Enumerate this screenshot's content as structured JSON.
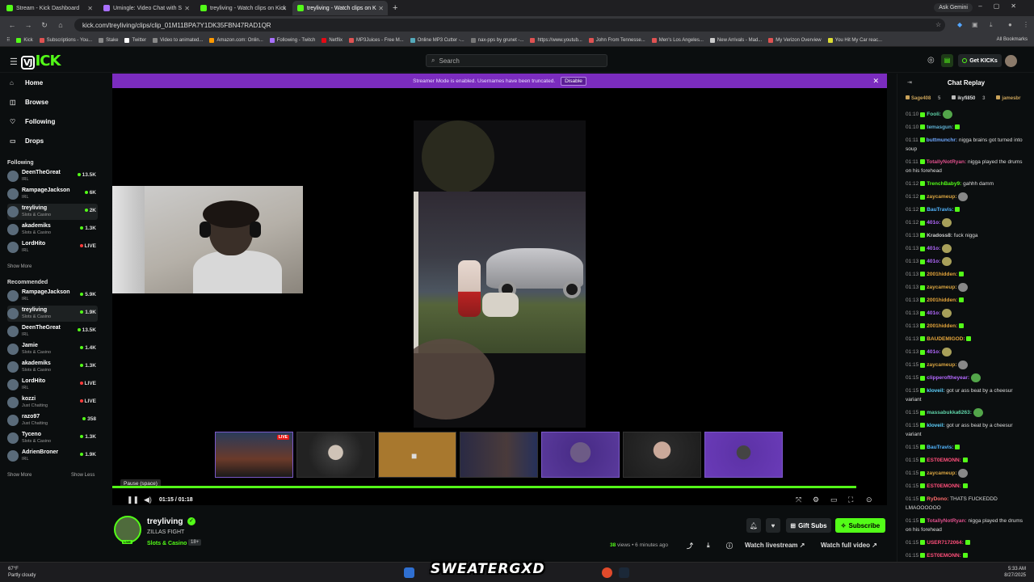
{
  "browser": {
    "tabs": [
      {
        "title": "Stream - Kick Dashboard",
        "active": false
      },
      {
        "title": "Umingle: Video Chat with S",
        "active": false
      },
      {
        "title": "treyliving - Watch clips on Kick",
        "active": false
      },
      {
        "title": "treyliving - Watch clips on K",
        "active": true
      }
    ],
    "ask_gemini": "Ask Gemini",
    "url": "kick.com/treyliving/clips/clip_01M11BPA7Y1DK35FBN47RAD1QR",
    "bookmarks": [
      "Kick",
      "Subscriptions - You...",
      "Stake",
      "Twitter",
      "Video to animated...",
      "Amazon.com: Onlin...",
      "Following - Twitch",
      "Netflix",
      "MP3Juices - Free M...",
      "Online MP3 Cutter -...",
      "nax-pps by grunet -...",
      "https://www.youtub...",
      "John From Tennesse...",
      "Men's Los Angeles...",
      "New Arrivals - Mad...",
      "My Verizon Overview",
      "You Hit My Car reac..."
    ],
    "all_bookmarks": "All Bookmarks"
  },
  "header": {
    "search_placeholder": "Search",
    "get_kicks": "Get KICKs"
  },
  "sidebar": {
    "nav": [
      "Home",
      "Browse",
      "Following",
      "Drops"
    ],
    "following_heading": "Following",
    "following": [
      {
        "name": "DeenTheGreat",
        "category": "IRL",
        "viewers": "13.5K",
        "live": false
      },
      {
        "name": "RampageJackson",
        "category": "IRL",
        "viewers": "6K",
        "live": false
      },
      {
        "name": "treyliving",
        "category": "Slots & Casino",
        "viewers": "2K",
        "live": false
      },
      {
        "name": "akademiks",
        "category": "Slots & Casino",
        "viewers": "1.3K",
        "live": false
      },
      {
        "name": "LordHito",
        "category": "IRL",
        "viewers": "LIVE",
        "live": true
      }
    ],
    "show_more_1": "Show More",
    "recommended_heading": "Recommended",
    "recommended": [
      {
        "name": "RampageJackson",
        "category": "IRL",
        "viewers": "5.9K",
        "live": false
      },
      {
        "name": "treyliving",
        "category": "Slots & Casino",
        "viewers": "1.9K",
        "live": false
      },
      {
        "name": "DeenTheGreat",
        "category": "IRL",
        "viewers": "13.5K",
        "live": false
      },
      {
        "name": "Jamie",
        "category": "Slots & Casino",
        "viewers": "1.4K",
        "live": false
      },
      {
        "name": "akademiks",
        "category": "Slots & Casino",
        "viewers": "1.3K",
        "live": false
      },
      {
        "name": "LordHito",
        "category": "IRL",
        "viewers": "LIVE",
        "live": true
      },
      {
        "name": "kozzi",
        "category": "Just Chatting",
        "viewers": "LIVE",
        "live": true
      },
      {
        "name": "razo97",
        "category": "Just Chatting",
        "viewers": "358",
        "live": false
      },
      {
        "name": "Tyceno",
        "category": "Slots & Casino",
        "viewers": "1.3K",
        "live": false
      },
      {
        "name": "AdrienBroner",
        "category": "IRL",
        "viewers": "1.9K",
        "live": false
      }
    ],
    "show_more_2": "Show More",
    "show_less": "Show Less"
  },
  "banner": {
    "text": "Streamer Mode is enabled. Usernames have been truncated.",
    "disable_label": "Disable"
  },
  "player": {
    "tooltip": "Pause (space)",
    "time": "01:15 / 01:18",
    "progress": 0.96,
    "thumb_live_tag": "LIVE"
  },
  "clip": {
    "streamer": "treyliving",
    "title": "ZILLAS FIGHT",
    "category": "Slots & Casino",
    "age_rating": "18+",
    "views_count": "38",
    "views_rest": " views • 6 minutes ago",
    "gift_subs": "Gift Subs",
    "subscribe": "Subscribe",
    "watch_livestream": "Watch livestream",
    "watch_full_video": "Watch full video"
  },
  "chat": {
    "title": "Chat Replay",
    "gifters": [
      {
        "name": "Sage408",
        "count": "5"
      },
      {
        "name": "ikyfi850",
        "count": "3"
      },
      {
        "name": "jamesbr",
        "count": ""
      }
    ],
    "messages": [
      {
        "time": "01:10",
        "user": "Fooli:",
        "color": "#5fd3a8",
        "text": "",
        "emote": "g"
      },
      {
        "time": "01:10",
        "user": "temasgun:",
        "color": "#5fb0d3",
        "text": "",
        "emote": "b"
      },
      {
        "time": "01:11",
        "user": "buttmunchr:",
        "color": "#6fa8ff",
        "text": " nigga brains got turned into soup",
        "emote": ""
      },
      {
        "time": "01:11",
        "user": "TotallyNotRyan:",
        "color": "#e0508c",
        "text": " nigga played the drums on his forehead",
        "emote": ""
      },
      {
        "time": "01:12",
        "user": "TrenchBaby9:",
        "color": "#53fc18",
        "text": " gahhh damm",
        "emote": ""
      },
      {
        "time": "01:12",
        "user": "zaycameup:",
        "color": "#d9a441",
        "text": "",
        "emote": "s"
      },
      {
        "time": "01:12",
        "user": "BauTravis:",
        "color": "#53b6ff",
        "text": "",
        "emote": "b"
      },
      {
        "time": "01:12",
        "user": "401o:",
        "color": "#b469ff",
        "text": "",
        "emote": "y"
      },
      {
        "time": "01:13",
        "user": "Kradoss8:",
        "color": "#cfcfcf",
        "text": " fuck nigga",
        "emote": ""
      },
      {
        "time": "01:13",
        "user": "401o:",
        "color": "#b469ff",
        "text": "",
        "emote": "y"
      },
      {
        "time": "01:13",
        "user": "401o:",
        "color": "#b469ff",
        "text": "",
        "emote": "y"
      },
      {
        "time": "01:13",
        "user": "2001hidden:",
        "color": "#e5a53b",
        "text": "",
        "emote": "b"
      },
      {
        "time": "01:13",
        "user": "zaycameup:",
        "color": "#d9a441",
        "text": "",
        "emote": "s"
      },
      {
        "time": "01:13",
        "user": "2001hidden:",
        "color": "#e5a53b",
        "text": "",
        "emote": "b"
      },
      {
        "time": "01:13",
        "user": "401o:",
        "color": "#b469ff",
        "text": "",
        "emote": "y"
      },
      {
        "time": "01:13",
        "user": "2001hidden:",
        "color": "#e5a53b",
        "text": "",
        "emote": "b"
      },
      {
        "time": "01:13",
        "user": "BAUDEMIGOD:",
        "color": "#e5a53b",
        "text": "",
        "emote": "b"
      },
      {
        "time": "01:13",
        "user": "401o:",
        "color": "#b469ff",
        "text": "",
        "emote": "y"
      },
      {
        "time": "01:15",
        "user": "zaycameup:",
        "color": "#d9a441",
        "text": "",
        "emote": "s"
      },
      {
        "time": "01:15",
        "user": "clipperoftheyear:",
        "color": "#b469ff",
        "text": "",
        "emote": "g"
      },
      {
        "time": "01:15",
        "user": "kloveil:",
        "color": "#5fd3ff",
        "text": " got ur ass beat by a cheesur variant",
        "emote": ""
      },
      {
        "time": "01:15",
        "user": "massabukka6263:",
        "color": "#5fd3a8",
        "text": "",
        "emote": "g"
      },
      {
        "time": "01:15",
        "user": "kloveil:",
        "color": "#5fd3ff",
        "text": " got ur ass beat by a cheesur variant",
        "emote": ""
      },
      {
        "time": "01:15",
        "user": "BauTravis:",
        "color": "#53b6ff",
        "text": "",
        "emote": "b"
      },
      {
        "time": "01:15",
        "user": "EST0EMONN:",
        "color": "#ff4f7a",
        "text": "",
        "emote": "b"
      },
      {
        "time": "01:15",
        "user": "zaycameup:",
        "color": "#d9a441",
        "text": "",
        "emote": "s"
      },
      {
        "time": "01:15",
        "user": "EST0EMONN:",
        "color": "#ff4f7a",
        "text": "",
        "emote": "b"
      },
      {
        "time": "01:15",
        "user": "RyDono:",
        "color": "#ff6b6b",
        "text": " THATS FUCKEDDD LMAOOOOOO",
        "emote": ""
      },
      {
        "time": "01:15",
        "user": "TotallyNotRyan:",
        "color": "#e0508c",
        "text": " nigga played the drums on his forehead",
        "emote": ""
      },
      {
        "time": "01:15",
        "user": "USER7172064:",
        "color": "#ff4f7a",
        "text": "",
        "emote": "b"
      },
      {
        "time": "01:15",
        "user": "EST0EMONN:",
        "color": "#ff4f7a",
        "text": "",
        "emote": "b"
      }
    ]
  },
  "taskbar": {
    "temp": "67°F",
    "weather": "Partly cloudy",
    "overlay_text": "SWEATERGXD",
    "time": "5:33 AM",
    "date": "8/27/2025"
  },
  "colors": {
    "kick_green": "#53fc18",
    "banner_purple": "#7b2cbf",
    "background": "#0b0e0f"
  }
}
